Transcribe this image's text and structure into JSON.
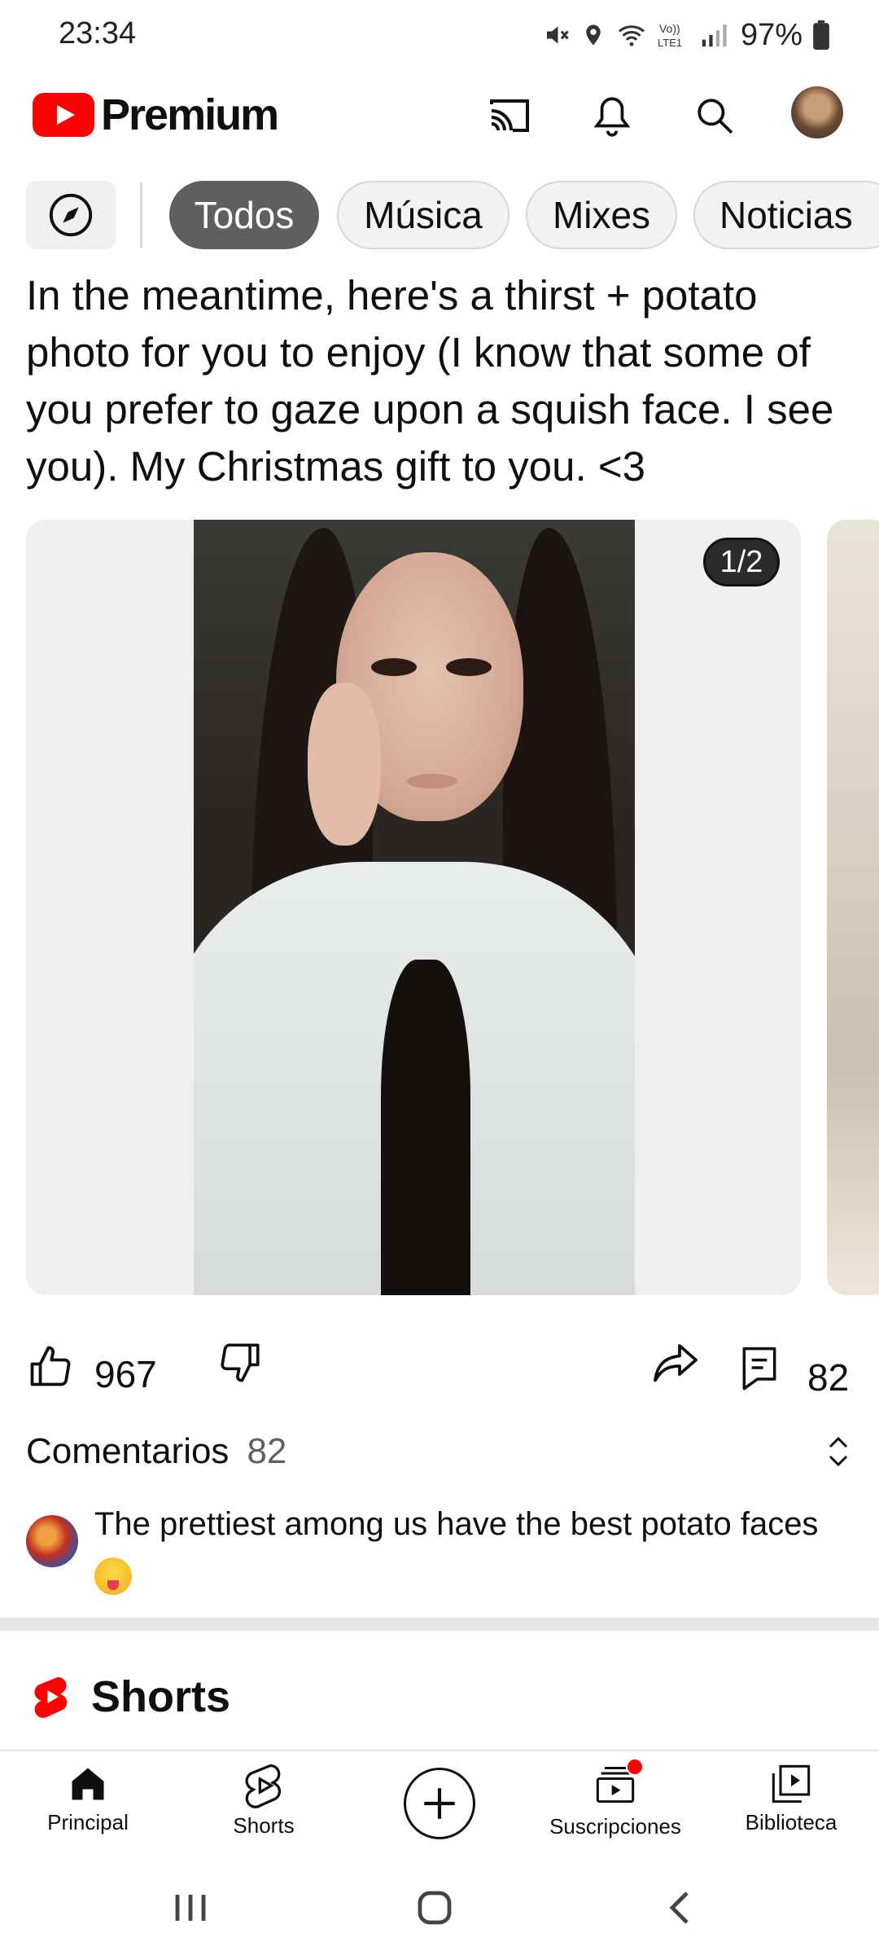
{
  "status_bar": {
    "time": "23:34",
    "battery": "97%",
    "icons": [
      "mute-icon",
      "location-icon",
      "wifi-icon",
      "volte-icon",
      "signal-icon",
      "battery-icon"
    ]
  },
  "header": {
    "logo_text": "Premium",
    "icons": [
      "cast-icon",
      "bell-icon",
      "search-icon",
      "avatar"
    ]
  },
  "chips": {
    "items": [
      {
        "label": "Todos",
        "active": true
      },
      {
        "label": "Música",
        "active": false
      },
      {
        "label": "Mixes",
        "active": false
      },
      {
        "label": "Noticias",
        "active": false
      }
    ]
  },
  "post": {
    "text": "In the meantime, here's a thirst + potato photo for you to enjoy (I know that some of you prefer to gaze upon a squish face. I see you). My Christmas gift to you. <3",
    "image_counter": "1/2"
  },
  "actions": {
    "likes": "967",
    "comments": "82"
  },
  "comments": {
    "title": "Comentarios",
    "count": "82",
    "top_comment": "The prettiest among us have the best potato faces"
  },
  "shorts": {
    "title": "Shorts"
  },
  "bottom_nav": {
    "items": [
      {
        "label": "Principal"
      },
      {
        "label": "Shorts"
      },
      {
        "label": "Suscripciones"
      },
      {
        "label": "Biblioteca"
      }
    ]
  },
  "colors": {
    "brand_red": "#ff0000",
    "chip_active": "#5f5f5f",
    "chip_bg": "#f2f2f2"
  }
}
